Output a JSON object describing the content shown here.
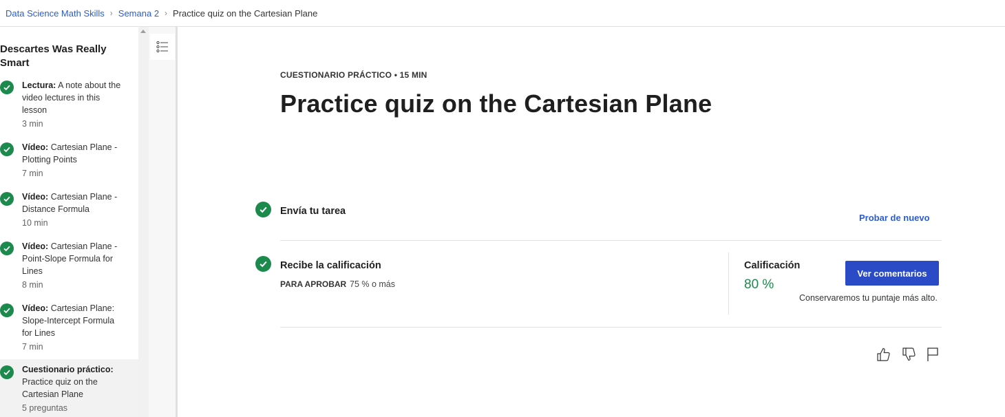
{
  "breadcrumb": {
    "items": [
      "Data Science Math Skills",
      "Semana 2"
    ],
    "current": "Practice quiz on the Cartesian Plane"
  },
  "sidebar": {
    "module_title": "Descartes Was Really Smart",
    "lessons": [
      {
        "type": "Lectura:",
        "title": "A note about the video lectures in this lesson",
        "meta": "3 min",
        "completed": true
      },
      {
        "type": "Vídeo:",
        "title": "Cartesian Plane - Plotting Points",
        "meta": "7 min",
        "completed": true
      },
      {
        "type": "Vídeo:",
        "title": "Cartesian Plane - Distance Formula",
        "meta": "10 min",
        "completed": true
      },
      {
        "type": "Vídeo:",
        "title": "Cartesian Plane - Point-Slope Formula for Lines",
        "meta": "8 min",
        "completed": true
      },
      {
        "type": "Vídeo:",
        "title": "Cartesian Plane: Slope-Intercept Formula for Lines",
        "meta": "7 min",
        "completed": true
      },
      {
        "type": "Cuestionario práctico:",
        "title": "Practice quiz on the Cartesian Plane",
        "meta": "5 preguntas",
        "completed": true,
        "active": true
      }
    ]
  },
  "main": {
    "eyebrow": "CUESTIONARIO PRÁCTICO • 15 MIN",
    "title": "Practice quiz on the Cartesian Plane",
    "submit": {
      "title": "Envía tu tarea",
      "retry_label": "Probar de nuevo"
    },
    "grade": {
      "title": "Recibe la calificación",
      "pass_label": "PARA APROBAR",
      "pass_value": "75 % o más",
      "grade_label": "Calificación",
      "grade_value": "80 %",
      "feedback_button": "Ver comentarios",
      "keep_note": "Conservaremos tu puntaje más alto."
    },
    "actions": {
      "like_icon": "thumbs-up-icon",
      "dislike_icon": "thumbs-down-icon",
      "report_icon": "flag-icon"
    }
  },
  "colors": {
    "accent": "#2a4bc5",
    "link": "#2a5bd7",
    "success": "#1b8a4c"
  }
}
